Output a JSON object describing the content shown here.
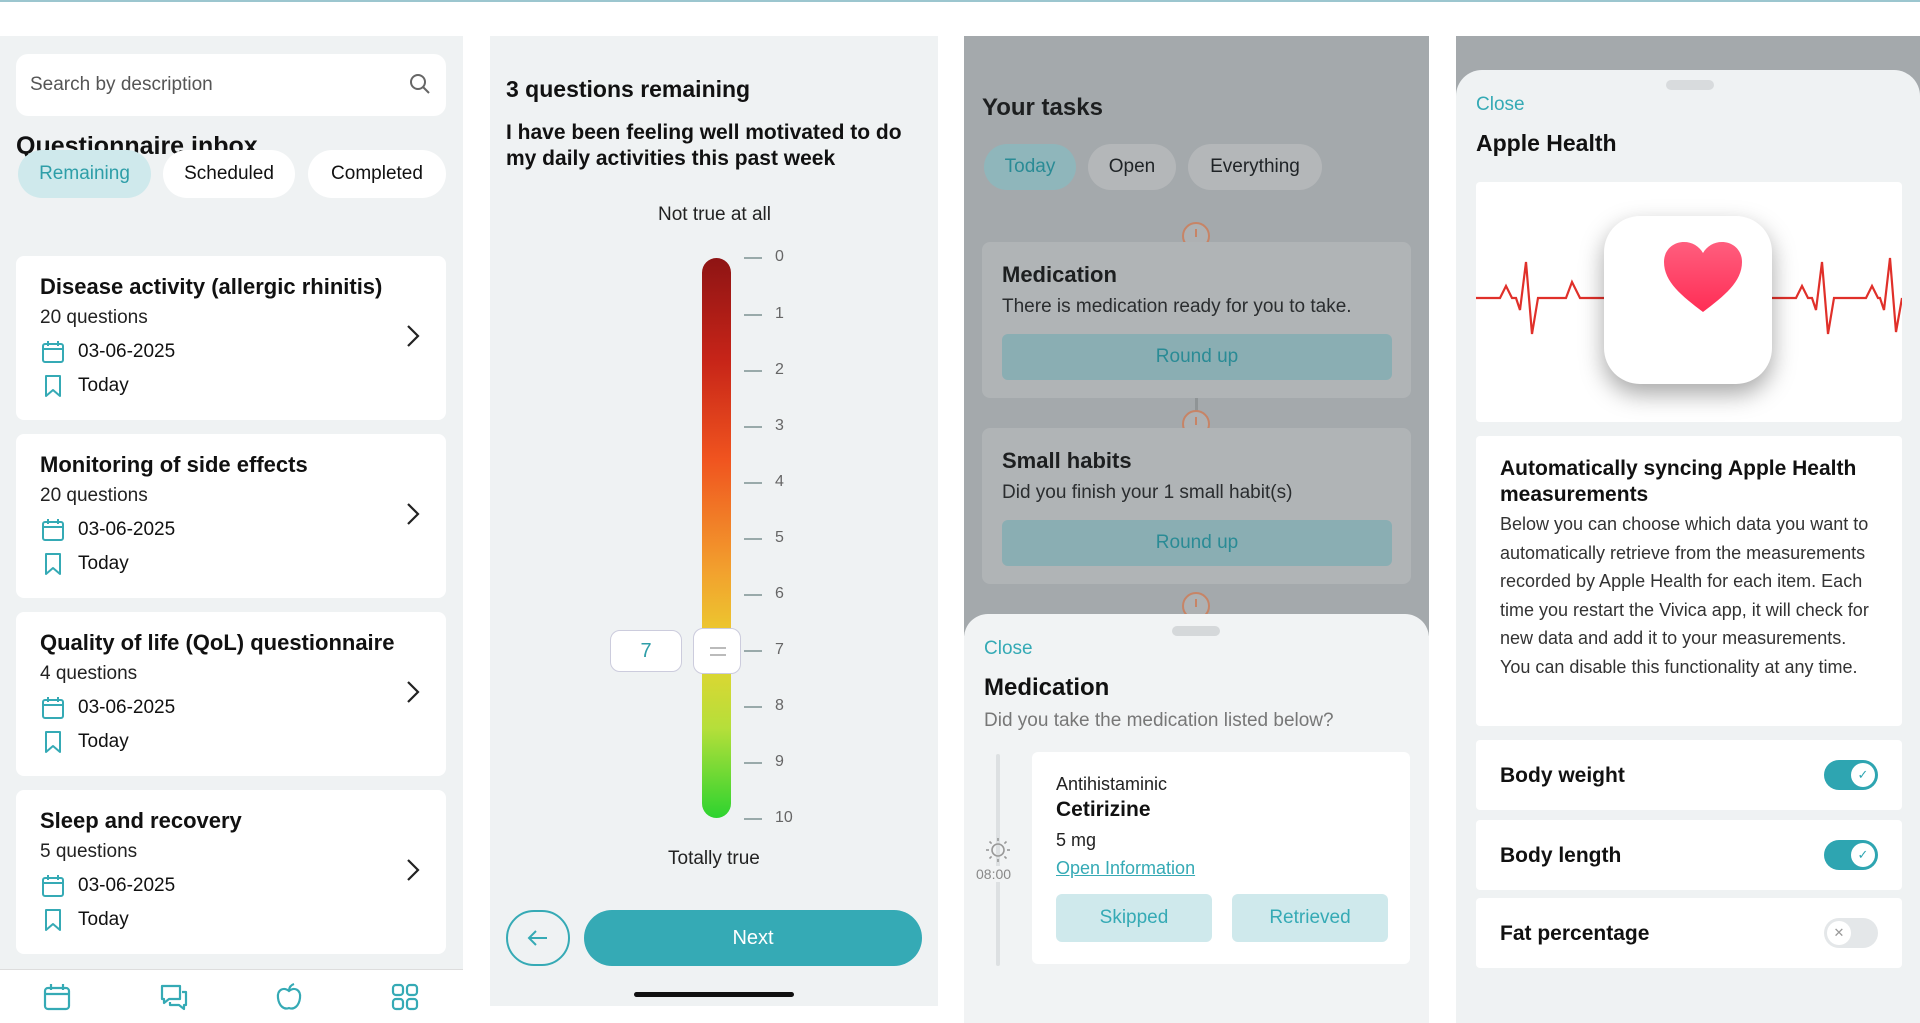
{
  "inbox": {
    "search_placeholder": "Search by description",
    "title": "Questionnaire inbox",
    "filters": [
      "Remaining",
      "Scheduled",
      "Completed"
    ],
    "items": [
      {
        "title": "Disease activity (allergic rhinitis)",
        "count": "20 questions",
        "date": "03-06-2025",
        "due": "Today"
      },
      {
        "title": "Monitoring of side effects",
        "count": "20 questions",
        "date": "03-06-2025",
        "due": "Today"
      },
      {
        "title": "Quality of life (QoL) questionnaire",
        "count": "4 questions",
        "date": "03-06-2025",
        "due": "Today"
      },
      {
        "title": "Sleep and recovery",
        "count": "5 questions",
        "date": "03-06-2025",
        "due": "Today"
      }
    ],
    "tab_icons": [
      "calendar-icon",
      "chat-icon",
      "apple-icon",
      "grid-icon"
    ]
  },
  "question": {
    "remaining": "3 questions remaining",
    "text": "I have been feeling well motivated to do my daily activities this past week",
    "top_label": "Not true at all",
    "bottom_label": "Totally true",
    "scale": [
      "0",
      "1",
      "2",
      "3",
      "4",
      "5",
      "6",
      "7",
      "8",
      "9",
      "10"
    ],
    "selected_value": "7",
    "next_label": "Next"
  },
  "tasks": {
    "title": "Your tasks",
    "filters": [
      "Today",
      "Open",
      "Everything"
    ],
    "cards": [
      {
        "title": "Medication",
        "desc": "There is medication ready for you to take.",
        "button": "Round up"
      },
      {
        "title": "Small habits",
        "desc": "Did you finish your 1 small habit(s)",
        "button": "Round up"
      }
    ],
    "sheet": {
      "close": "Close",
      "title": "Medication",
      "subtitle": "Did you take the medication listed below?",
      "time": "08:00",
      "category": "Antihistaminic",
      "name": "Cetirizine",
      "dose": "5 mg",
      "link": "Open Information",
      "skipped": "Skipped",
      "retrieved": "Retrieved"
    }
  },
  "health": {
    "close": "Close",
    "title": "Apple Health",
    "heading": "Automatically syncing Apple Health measurements",
    "body": "Below you can choose which data you want to automatically retrieve from the measurements recorded by Apple Health for each item. Each time you restart the Vivica app, it will check for new data and add it to your measurements. You can disable this functionality at any time.",
    "toggles": [
      {
        "label": "Body weight",
        "on": true
      },
      {
        "label": "Body length",
        "on": true
      },
      {
        "label": "Fat percentage",
        "on": false
      }
    ]
  },
  "colors": {
    "accent": "#35aab5",
    "accent_light": "#cfe9ec",
    "heart": "#ff3b5c",
    "ecg": "#e0302a"
  }
}
